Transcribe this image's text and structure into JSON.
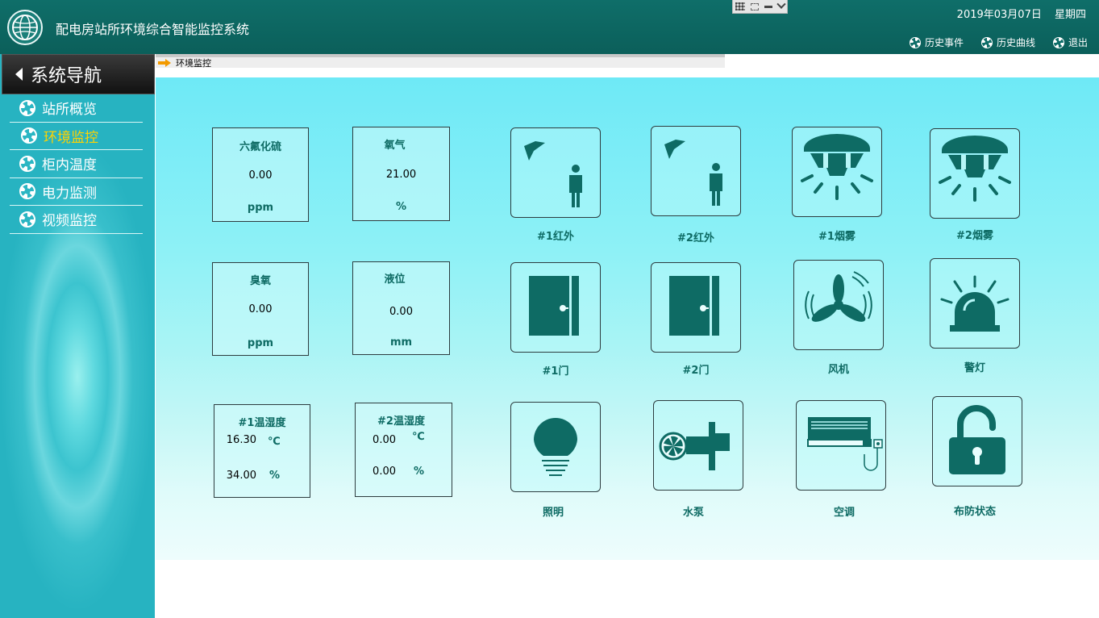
{
  "header": {
    "title": "配电房站所环境综合智能监控系统",
    "date": "2019年03月07日",
    "weekday": "星期四",
    "links": [
      {
        "label": "历史事件",
        "icon": "ring-icon"
      },
      {
        "label": "历史曲线",
        "icon": "ring-icon"
      },
      {
        "label": "退出",
        "icon": "ring-icon"
      }
    ]
  },
  "sidebar": {
    "title": "系统导航",
    "items": [
      {
        "label": "站所概览",
        "active": false
      },
      {
        "label": "环境监控",
        "active": true
      },
      {
        "label": "柜内温度",
        "active": false
      },
      {
        "label": "电力监测",
        "active": false
      },
      {
        "label": "视频监控",
        "active": false
      }
    ]
  },
  "breadcrumb": {
    "label": "环境监控"
  },
  "sensors": {
    "sf6": {
      "title": "六氟化硫",
      "value": "0.00",
      "unit": "ppm"
    },
    "oxygen": {
      "title": "氧气",
      "value": "21.00",
      "unit": "%"
    },
    "ozone": {
      "title": "臭氧",
      "value": "0.00",
      "unit": "ppm"
    },
    "level": {
      "title": "液位",
      "value": "0.00",
      "unit": "mm"
    },
    "th1": {
      "title": "#1温湿度",
      "temp": "16.30",
      "temp_unit": "℃",
      "hum": "34.00",
      "hum_unit": "%"
    },
    "th2": {
      "title": "#2温湿度",
      "temp": "0.00",
      "temp_unit": "℃",
      "hum": "0.00",
      "hum_unit": "%"
    }
  },
  "devices": {
    "ir1": {
      "label": "#1红外",
      "icon": "infrared-person-icon"
    },
    "ir2": {
      "label": "#2红外",
      "icon": "infrared-person-icon"
    },
    "smoke1": {
      "label": "#1烟雾",
      "icon": "smoke-detector-icon"
    },
    "smoke2": {
      "label": "#2烟雾",
      "icon": "smoke-detector-icon"
    },
    "door1": {
      "label": "#1门",
      "icon": "door-icon"
    },
    "door2": {
      "label": "#2门",
      "icon": "door-icon"
    },
    "fan": {
      "label": "风机",
      "icon": "fan-icon"
    },
    "alarm": {
      "label": "警灯",
      "icon": "alarm-light-icon"
    },
    "light": {
      "label": "照明",
      "icon": "light-bulb-icon"
    },
    "pump": {
      "label": "水泵",
      "icon": "water-pump-icon"
    },
    "ac": {
      "label": "空调",
      "icon": "air-conditioner-icon"
    },
    "arm": {
      "label": "布防状态",
      "icon": "padlock-icon"
    }
  },
  "colors": {
    "header_bg": "#0f6e69",
    "accent_active": "#ffd200",
    "icon_color": "#0e6b64",
    "panel_top": "#6ee9f6"
  }
}
